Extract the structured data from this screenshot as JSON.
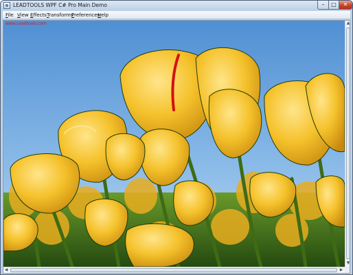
{
  "window": {
    "title": "LEADTOOLS WPF C# Pro Main Demo",
    "controls": {
      "minimize": "–",
      "maximize": "□",
      "close": "✕"
    }
  },
  "menu": [
    {
      "label": "File",
      "access_key": "F",
      "rest": "ile"
    },
    {
      "label": "View",
      "access_key": "V",
      "rest": "iew"
    },
    {
      "label": "Effects",
      "access_key": "E",
      "rest": "ffects"
    },
    {
      "label": "Transforms",
      "access_key": "T",
      "rest": "ransforms"
    },
    {
      "label": "Preferences",
      "access_key": "P",
      "rest": "references"
    },
    {
      "label": "Help",
      "access_key": "H",
      "rest": "elp"
    }
  ],
  "viewer": {
    "watermark": "www.Leadtools.com",
    "image_subject": "yellow tulips against blue sky"
  },
  "scrollbars": {
    "up": "▲",
    "down": "▼",
    "left": "◀",
    "right": "▶"
  },
  "colors": {
    "watermark": "#e01818",
    "sky": "#5f9fdd",
    "petal": "#f2b81f",
    "stem": "#4f7a1c"
  },
  "icons": [
    "app-icon",
    "minimize-icon",
    "maximize-icon",
    "close-icon"
  ]
}
